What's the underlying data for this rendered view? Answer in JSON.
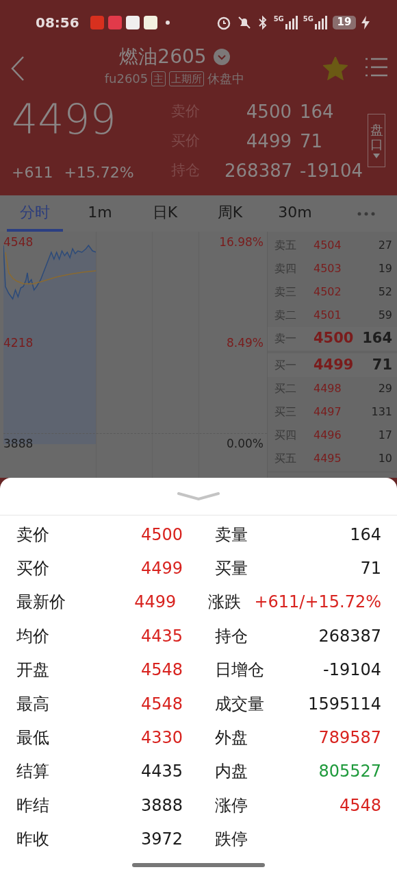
{
  "status_bar": {
    "time": "08:56",
    "network_labels": [
      "5G",
      "5G"
    ],
    "battery": "19"
  },
  "header": {
    "title": "燃油2605",
    "code": "fu2605",
    "tags": [
      "主",
      "上期所"
    ],
    "session": "休盘中",
    "favorite": true
  },
  "quote": {
    "price": "4499",
    "change": "+611",
    "change_pct": "+15.72%",
    "rows": [
      {
        "label": "卖价",
        "value": "4500",
        "extra": "164"
      },
      {
        "label": "买价",
        "value": "4499",
        "extra": "71"
      },
      {
        "label": "持仓",
        "value": "268387",
        "extra": "-19104"
      }
    ],
    "side_button": "盘口"
  },
  "tabs": [
    {
      "label": "分时",
      "selected": true
    },
    {
      "label": "1m",
      "selected": false
    },
    {
      "label": "日K",
      "selected": false
    },
    {
      "label": "周K",
      "selected": false
    },
    {
      "label": "30m",
      "selected": false
    }
  ],
  "chart": {
    "price_labels": [
      {
        "text": "4548",
        "color": "#7a1c1c"
      },
      {
        "text": "4218",
        "color": "#7a1c1c"
      },
      {
        "text": "3888",
        "color": "#1e1e1e"
      }
    ],
    "pct_labels": [
      {
        "text": "16.98%",
        "color": "#7a1c1c"
      },
      {
        "text": "8.49%",
        "color": "#7a1c1c"
      },
      {
        "text": "0.00%",
        "color": "#1e1e1e"
      }
    ]
  },
  "order_book": {
    "asks": [
      {
        "label": "卖五",
        "price": "4504",
        "volume": "27",
        "best": false
      },
      {
        "label": "卖四",
        "price": "4503",
        "volume": "19",
        "best": false
      },
      {
        "label": "卖三",
        "price": "4502",
        "volume": "52",
        "best": false
      },
      {
        "label": "卖二",
        "price": "4501",
        "volume": "59",
        "best": false
      },
      {
        "label": "卖一",
        "price": "4500",
        "volume": "164",
        "best": true
      }
    ],
    "bids": [
      {
        "label": "买一",
        "price": "4499",
        "volume": "71",
        "best": true
      },
      {
        "label": "买二",
        "price": "4498",
        "volume": "29",
        "best": false
      },
      {
        "label": "买三",
        "price": "4497",
        "volume": "131",
        "best": false
      },
      {
        "label": "买四",
        "price": "4496",
        "volume": "17",
        "best": false
      },
      {
        "label": "买五",
        "price": "4495",
        "volume": "10",
        "best": false
      }
    ]
  },
  "details": [
    {
      "left": {
        "label": "卖价",
        "value": "4500",
        "color": "#d8231f"
      },
      "right": {
        "label": "卖量",
        "value": "164",
        "color": "#1a1a1a"
      }
    },
    {
      "left": {
        "label": "买价",
        "value": "4499",
        "color": "#d8231f"
      },
      "right": {
        "label": "买量",
        "value": "71",
        "color": "#1a1a1a"
      }
    },
    {
      "left": {
        "label": "最新价",
        "value": "4499",
        "color": "#d8231f"
      },
      "right": {
        "label": "涨跌",
        "value": "+611/+15.72%",
        "color": "#d8231f"
      }
    },
    {
      "left": {
        "label": "均价",
        "value": "4435",
        "color": "#d8231f"
      },
      "right": {
        "label": "持仓",
        "value": "268387",
        "color": "#1a1a1a"
      }
    },
    {
      "left": {
        "label": "开盘",
        "value": "4548",
        "color": "#d8231f"
      },
      "right": {
        "label": "日增仓",
        "value": "-19104",
        "color": "#1a1a1a"
      }
    },
    {
      "left": {
        "label": "最高",
        "value": "4548",
        "color": "#d8231f"
      },
      "right": {
        "label": "成交量",
        "value": "1595114",
        "color": "#1a1a1a"
      }
    },
    {
      "left": {
        "label": "最低",
        "value": "4330",
        "color": "#d8231f"
      },
      "right": {
        "label": "外盘",
        "value": "789587",
        "color": "#d8231f"
      }
    },
    {
      "left": {
        "label": "结算",
        "value": "4435",
        "color": "#1a1a1a"
      },
      "right": {
        "label": "内盘",
        "value": "805527",
        "color": "#1f9a3c"
      }
    },
    {
      "left": {
        "label": "昨结",
        "value": "3888",
        "color": "#1a1a1a"
      },
      "right": {
        "label": "涨停",
        "value": "4548",
        "color": "#d8231f"
      }
    },
    {
      "left": {
        "label": "昨收",
        "value": "3972",
        "color": "#1a1a1a"
      },
      "right": {
        "label": "跌停"
      }
    }
  ]
}
